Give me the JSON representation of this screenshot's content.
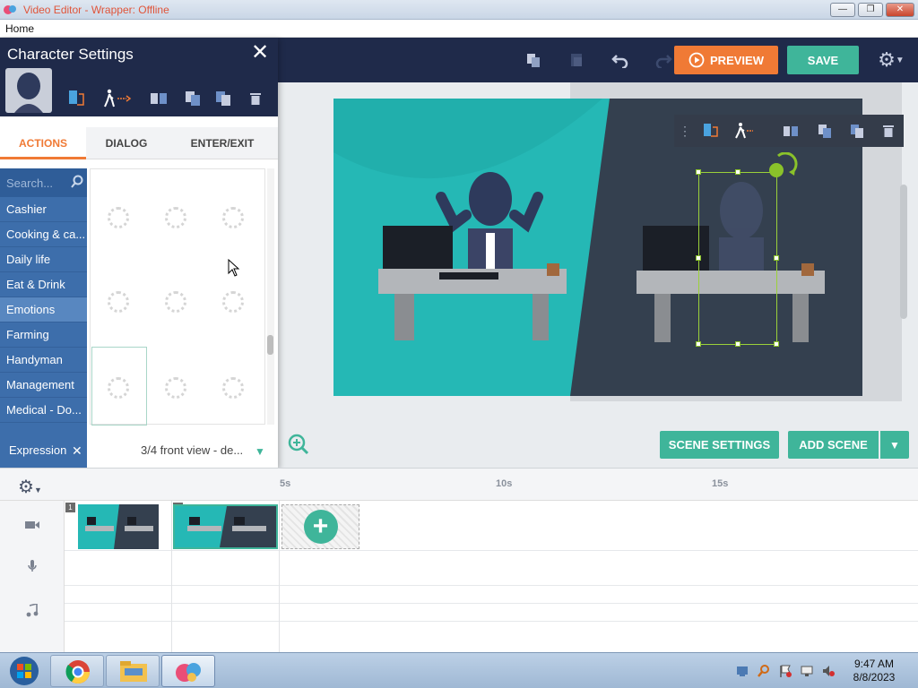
{
  "window": {
    "title": "Video Editor - Wrapper: Offline",
    "menu": "Home",
    "minimize": "—",
    "maximize": "❐",
    "close": "✕"
  },
  "toolbar": {
    "preview_label": "PREVIEW",
    "save_label": "SAVE"
  },
  "panel": {
    "title": "Character Settings",
    "tabs": [
      "ACTIONS",
      "DIALOG",
      "ENTER/EXIT"
    ],
    "search_placeholder": "Search...",
    "categories": [
      "Cashier",
      "Cooking & ca...",
      "Daily life",
      "Eat & Drink",
      "Emotions",
      "Farming",
      "Handyman",
      "Management",
      "Medical - Do..."
    ],
    "active_category": "Emotions",
    "expression_label": "Expression",
    "expression_value": "3/4 front view - de..."
  },
  "stage": {
    "scene_settings_label": "SCENE SETTINGS",
    "add_scene_label": "ADD SCENE"
  },
  "timeline": {
    "ticks": [
      "5s",
      "10s",
      "15s"
    ],
    "scenes": [
      "1",
      "2"
    ]
  },
  "taskbar": {
    "time": "9:47 AM",
    "date": "8/8/2023"
  },
  "colors": {
    "navy": "#1f2a4a",
    "accent_orange": "#f07a35",
    "accent_teal": "#3fb59a",
    "category_blue": "#3d6eab",
    "stage_teal": "#25b8b5"
  }
}
